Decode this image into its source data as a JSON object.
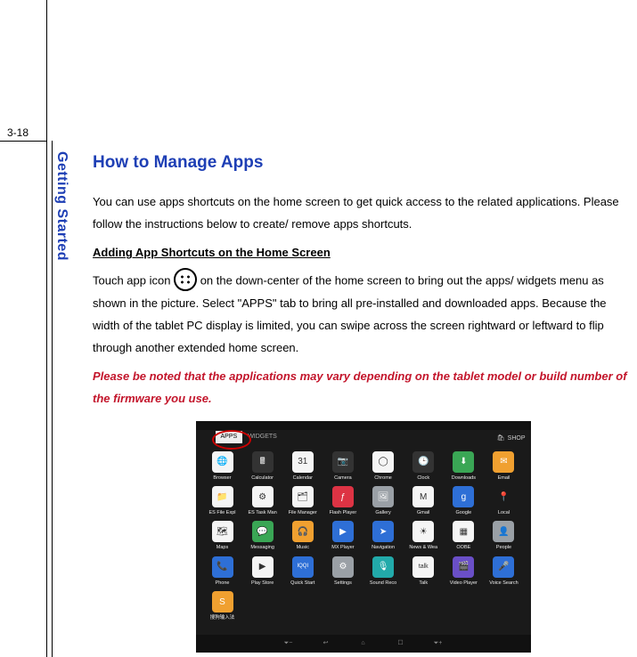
{
  "page_number": "3-18",
  "section_label": "Getting Started",
  "heading": "How to Manage Apps",
  "intro": "You can use apps shortcuts on the home screen to get quick access to the related applications. Please follow the instructions below to create/ remove apps shortcuts.",
  "subheading": "Adding App Shortcuts on the Home Screen",
  "para_lead": "Touch app icon",
  "para_rest": " on the down-center of the home screen to bring out the apps/ widgets menu as shown in the picture. Select \"APPS\" tab to bring all pre-installed and downloaded apps. Because the width of the tablet PC display is limited, you can swipe across the screen rightward or leftward to flip through another extended home screen.",
  "warning": "Please be noted that the applications may vary depending on the tablet model or build number of the firmware you use.",
  "tablet": {
    "tab_apps": "APPS",
    "tab_widgets": "WIDGETS",
    "shop_label": "SHOP",
    "apps": {
      "r1": [
        "Browser",
        "Calculator",
        "Calendar",
        "Camera",
        "Chrome",
        "Clock",
        "Downloads",
        "Email"
      ],
      "r2": [
        "ES File Expl",
        "ES Task Man",
        "File Manager",
        "Flash Player",
        "Gallery",
        "Gmail",
        "Google",
        "Local"
      ],
      "r3": [
        "Maps",
        "Messaging",
        "Music",
        "MX Player",
        "Navigation",
        "News & Wea",
        "OOBE",
        "People"
      ],
      "r4": [
        "Phone",
        "Play Store",
        "Quick Start",
        "Settings",
        "Sound Reco",
        "Talk",
        "Video Player",
        "Voice Search"
      ],
      "r5": [
        "搜狗输入法"
      ]
    }
  }
}
